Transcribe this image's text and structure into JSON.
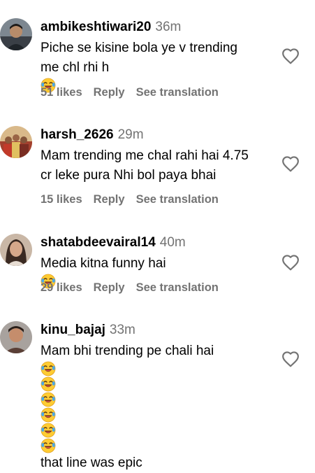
{
  "comments": [
    {
      "username": "ambikeshtiwari20",
      "time": "36m",
      "lines": [
        "Piche se kisine bola ye v trending",
        "me chl rhi h"
      ],
      "likes": "51 likes",
      "reply": "Reply",
      "translate": "See translation",
      "avatar_colors": [
        "#6f7a82",
        "#2c3238"
      ]
    },
    {
      "username": "harsh_2626",
      "time": "29m",
      "lines": [
        "Mam trending me chal rahi hai 4.75",
        "cr leke pura Nhi bol paya bhai"
      ],
      "likes": "15 likes",
      "reply": "Reply",
      "translate": "See translation",
      "avatar_colors": [
        "#c9a26b",
        "#8a3b2c"
      ]
    },
    {
      "username": "shatabdeevairal14",
      "time": "40m",
      "lines": [
        "Media kitna funny hai"
      ],
      "likes": "29 likes",
      "reply": "Reply",
      "translate": "See translation",
      "avatar_colors": [
        "#b59c86",
        "#4a3328"
      ]
    },
    {
      "username": "kinu_bajaj",
      "time": "33m",
      "lines": [
        "Mam bhi trending pe chali hai",
        "that line was epic"
      ],
      "likes": "",
      "reply": "",
      "translate": "",
      "avatar_colors": [
        "#9a8f8a",
        "#3b2c28"
      ]
    }
  ],
  "icons": {
    "like": "heart-outline-icon",
    "emoji": "face-with-tears-of-joy-icon"
  },
  "colors": {
    "text": "#000000",
    "secondary": "#737373",
    "emoji_face": "#ffcc33"
  }
}
